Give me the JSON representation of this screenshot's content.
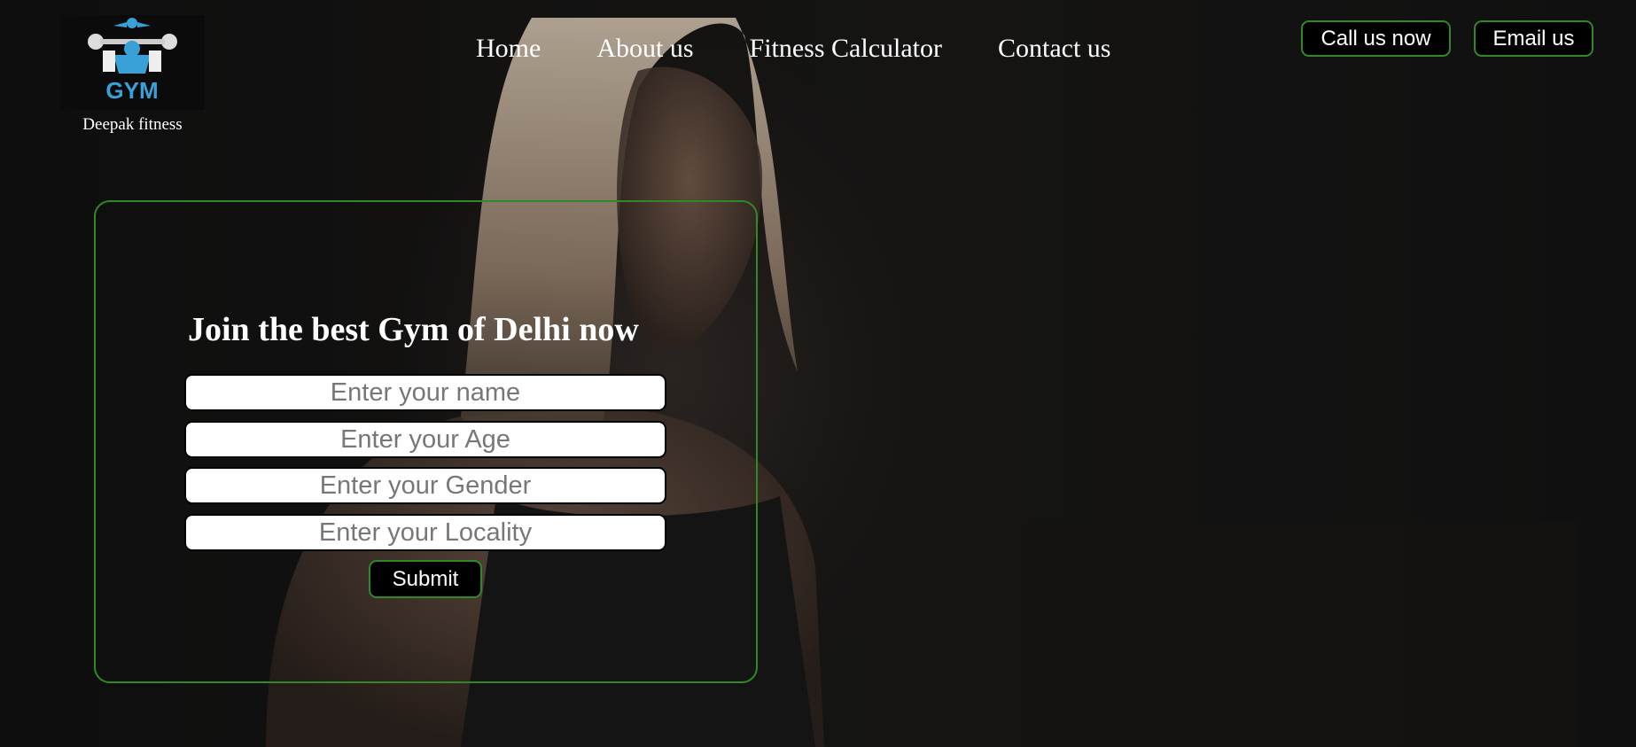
{
  "brand": {
    "logo_text": "GYM",
    "logo_icon": "bodybuilder-dumbbell-logo",
    "name": "Deepak fitness"
  },
  "nav": {
    "items": [
      {
        "label": "Home"
      },
      {
        "label": "About us"
      },
      {
        "label": "Fitness Calculator"
      },
      {
        "label": "Contact us"
      }
    ]
  },
  "header_actions": {
    "call_label": "Call us now",
    "email_label": "Email us"
  },
  "form": {
    "title": "Join the best Gym of Delhi now",
    "fields": [
      {
        "placeholder": "Enter your name"
      },
      {
        "placeholder": "Enter your Age"
      },
      {
        "placeholder": "Enter your Gender"
      },
      {
        "placeholder": "Enter your Locality"
      }
    ],
    "submit_label": "Submit"
  },
  "colors": {
    "accent": "#2f8a26",
    "background": "#111111",
    "text": "#ffffff",
    "logo_blue": "#3aa0d8"
  }
}
